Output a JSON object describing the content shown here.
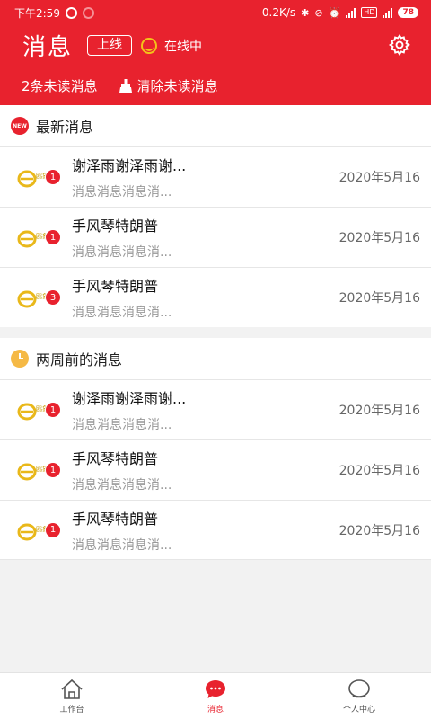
{
  "statusbar": {
    "time": "下午2:59",
    "net_speed": "0.2K/s",
    "battery": "78",
    "hd": "HD"
  },
  "header": {
    "title": "消息",
    "online_button": "上线",
    "status_text": "在线中"
  },
  "subbar": {
    "unread_count": "2条未读消息",
    "clear_label": "清除未读消息"
  },
  "sections": [
    {
      "badge": "NEW",
      "title": "最新消息",
      "items": [
        {
          "count": "1",
          "title": "谢泽雨谢泽雨谢...",
          "preview": "消息消息消息消...",
          "date": "2020年5月16"
        },
        {
          "count": "1",
          "title": "手风琴特朗普",
          "preview": "消息消息消息消...",
          "date": "2020年5月16"
        },
        {
          "count": "3",
          "title": "手风琴特朗普",
          "preview": "消息消息消息消...",
          "date": "2020年5月16"
        }
      ]
    },
    {
      "title": "两周前的消息",
      "items": [
        {
          "count": "1",
          "title": "谢泽雨谢泽雨谢...",
          "preview": "消息消息消息消...",
          "date": "2020年5月16"
        },
        {
          "count": "1",
          "title": "手风琴特朗普",
          "preview": "消息消息消息消...",
          "date": "2020年5月16"
        },
        {
          "count": "1",
          "title": "手风琴特朗普",
          "preview": "消息消息消息消...",
          "date": "2020年5月16"
        }
      ]
    }
  ],
  "tabbar": {
    "tabs": [
      {
        "label": "工作台",
        "icon": "home-icon"
      },
      {
        "label": "消息",
        "icon": "chat-icon"
      },
      {
        "label": "个人中心",
        "icon": "profile-icon"
      }
    ]
  },
  "logo_text": "鸥象",
  "colors": {
    "brand_red": "#e8222e",
    "accent_yellow": "#f3c21a",
    "clock_orange": "#f5b945"
  }
}
